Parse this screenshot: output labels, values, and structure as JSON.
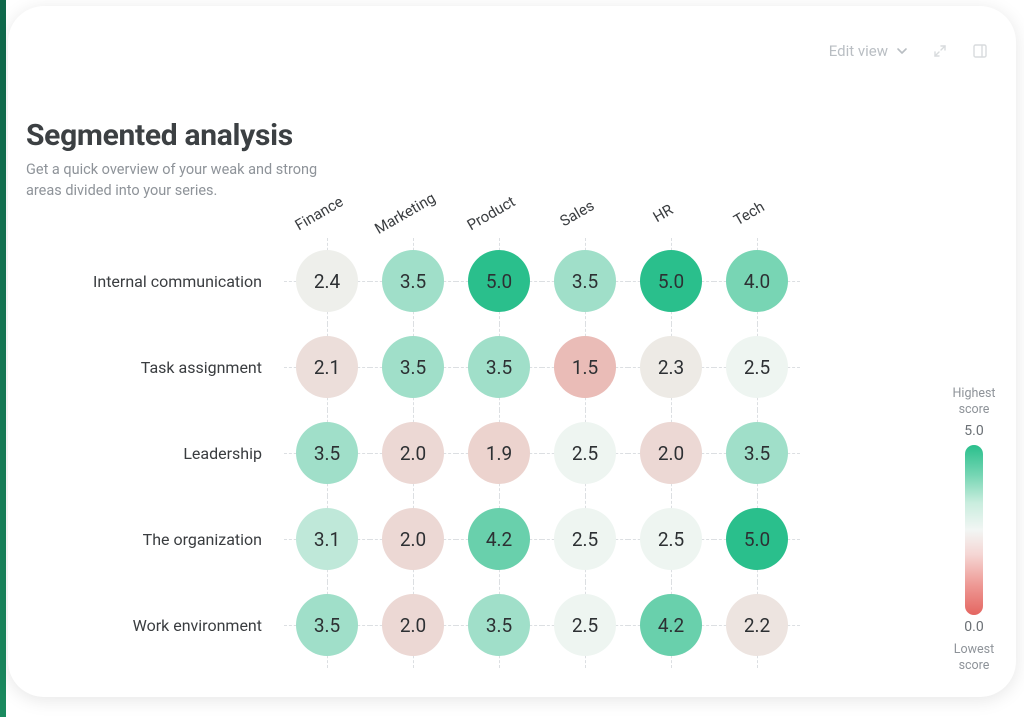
{
  "header": {
    "edit_view_label": "Edit view"
  },
  "title": "Segmented analysis",
  "subtitle": "Get a quick overview of your weak and strong areas divided into your series.",
  "columns": [
    "Finance",
    "Marketing",
    "Product",
    "Sales",
    "HR",
    "Tech"
  ],
  "rows": [
    {
      "label": "Internal communication",
      "values": [
        2.4,
        3.5,
        5.0,
        3.5,
        5.0,
        4.0
      ]
    },
    {
      "label": "Task assignment",
      "values": [
        2.1,
        3.5,
        3.5,
        1.5,
        2.3,
        2.5
      ]
    },
    {
      "label": "Leadership",
      "values": [
        3.5,
        2.0,
        1.9,
        2.5,
        2.0,
        3.5
      ]
    },
    {
      "label": "The organization",
      "values": [
        3.1,
        2.0,
        4.2,
        2.5,
        2.5,
        5.0
      ]
    },
    {
      "label": "Work environment",
      "values": [
        3.5,
        2.0,
        3.5,
        2.5,
        4.2,
        2.2
      ]
    }
  ],
  "legend": {
    "high_label": "Highest score",
    "low_label": "Lowest score",
    "max": "5.0",
    "min": "0.0"
  },
  "scale": {
    "min": 0.0,
    "max": 5.0,
    "color_low": "#e46661",
    "color_mid": "#eef5f1",
    "color_high": "#2abf8c"
  },
  "chart_data": {
    "type": "heatmap",
    "title": "Segmented analysis",
    "xlabel": "",
    "ylabel": "",
    "x_categories": [
      "Finance",
      "Marketing",
      "Product",
      "Sales",
      "HR",
      "Tech"
    ],
    "y_categories": [
      "Internal communication",
      "Task assignment",
      "Leadership",
      "The organization",
      "Work environment"
    ],
    "values": [
      [
        2.4,
        3.5,
        5.0,
        3.5,
        5.0,
        4.0
      ],
      [
        2.1,
        3.5,
        3.5,
        1.5,
        2.3,
        2.5
      ],
      [
        3.5,
        2.0,
        1.9,
        2.5,
        2.0,
        3.5
      ],
      [
        3.1,
        2.0,
        4.2,
        2.5,
        2.5,
        5.0
      ],
      [
        3.5,
        2.0,
        3.5,
        2.5,
        4.2,
        2.2
      ]
    ],
    "value_range": [
      0.0,
      5.0
    ],
    "legend_labels": {
      "high": "Highest score",
      "low": "Lowest score"
    }
  }
}
